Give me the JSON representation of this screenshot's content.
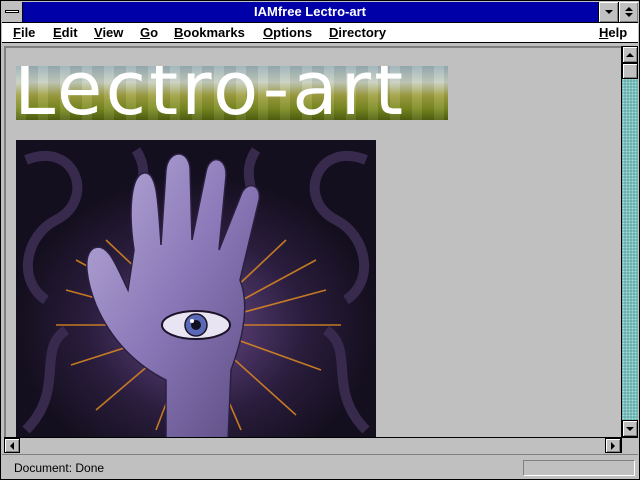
{
  "window": {
    "title": "IAMfree Lectro-art"
  },
  "menu": {
    "items": [
      {
        "label": "File",
        "underline": "F",
        "rest": "ile"
      },
      {
        "label": "Edit",
        "underline": "E",
        "rest": "dit"
      },
      {
        "label": "View",
        "underline": "V",
        "rest": "iew"
      },
      {
        "label": "Go",
        "underline": "G",
        "rest": "o"
      },
      {
        "label": "Bookmarks",
        "underline": "B",
        "rest": "ookmarks"
      },
      {
        "label": "Options",
        "underline": "O",
        "rest": "ptions"
      },
      {
        "label": "Directory",
        "underline": "D",
        "rest": "irectory"
      },
      {
        "label": "Help",
        "underline": "H",
        "rest": "elp"
      }
    ]
  },
  "page": {
    "banner_text": "Lectro-art"
  },
  "status": {
    "text": "Document: Done"
  },
  "colors": {
    "titlebar": "#0000a8",
    "scroll_track": "#5fa8a8",
    "chrome": "#c0c0c0"
  },
  "icons": {
    "system_menu": "system-menu-icon",
    "minimize": "minimize-icon",
    "maximize": "maximize-icon"
  }
}
